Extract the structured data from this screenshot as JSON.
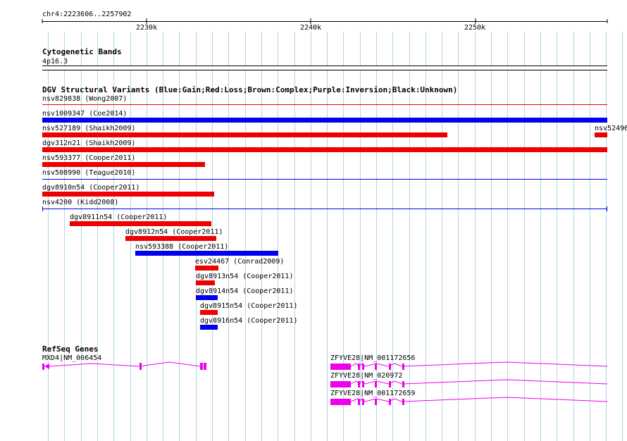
{
  "ruler": {
    "region": "chr4:2223606..2257902",
    "ticks": [
      "2230k",
      "2240k",
      "2250k"
    ]
  },
  "tracks": {
    "cytoband": {
      "title": "Cytogenetic Bands",
      "band": "4p16.3"
    },
    "dgv": {
      "title": "DGV Structural Variants (Blue:Gain;Red:Loss;Brown:Complex;Purple:Inversion;Black:Unknown)",
      "variants": [
        {
          "id": "nsv829838",
          "label": "nsv829838 (Wong2007)",
          "type": "loss"
        },
        {
          "id": "nsv1009347",
          "label": "nsv1009347 (Coe2014)",
          "type": "gain"
        },
        {
          "id": "nsv527189",
          "label": "nsv527189 (Shaikh2009)",
          "type": "loss"
        },
        {
          "id": "nsv52496",
          "label": "nsv52496",
          "type": "loss"
        },
        {
          "id": "dgv312n21",
          "label": "dgv312n21 (Shaikh2009)",
          "type": "loss"
        },
        {
          "id": "nsv593377",
          "label": "nsv593377 (Cooper2011)",
          "type": "loss"
        },
        {
          "id": "nsv508990",
          "label": "nsv508990 (Teague2010)",
          "type": "gain"
        },
        {
          "id": "dgv8910n54",
          "label": "dgv8910n54 (Cooper2011)",
          "type": "loss"
        },
        {
          "id": "nsv4200",
          "label": "nsv4200 (Kidd2008)",
          "type": "gain"
        },
        {
          "id": "dgv8911n54",
          "label": "dgv8911n54 (Cooper2011)",
          "type": "loss"
        },
        {
          "id": "dgv8912n54",
          "label": "dgv8912n54 (Cooper2011)",
          "type": "loss"
        },
        {
          "id": "nsv593388",
          "label": "nsv593388 (Cooper2011)",
          "type": "gain"
        },
        {
          "id": "esv24467",
          "label": "esv24467 (Conrad2009)",
          "type": "loss"
        },
        {
          "id": "dgv8913n54",
          "label": "dgv8913n54 (Cooper2011)",
          "type": "loss"
        },
        {
          "id": "dgv8914n54",
          "label": "dgv8914n54 (Cooper2011)",
          "type": "gain"
        },
        {
          "id": "dgv8915n54",
          "label": "dgv8915n54 (Cooper2011)",
          "type": "loss"
        },
        {
          "id": "dgv8916n54",
          "label": "dgv8916n54 (Cooper2011)",
          "type": "gain"
        }
      ]
    },
    "refseq": {
      "title": "RefSeq Genes",
      "genes": [
        {
          "label": "MXD4|NM_006454"
        },
        {
          "label": "ZFYVE28|NM_001172656"
        },
        {
          "label": "ZFYVE28|NM_020972"
        },
        {
          "label": "ZFYVE28|NM_001172659"
        }
      ]
    }
  },
  "colors": {
    "gain": "#0000ee",
    "loss": "#ee0000",
    "gene": "#ee00ee",
    "grid": "#add8e6"
  }
}
